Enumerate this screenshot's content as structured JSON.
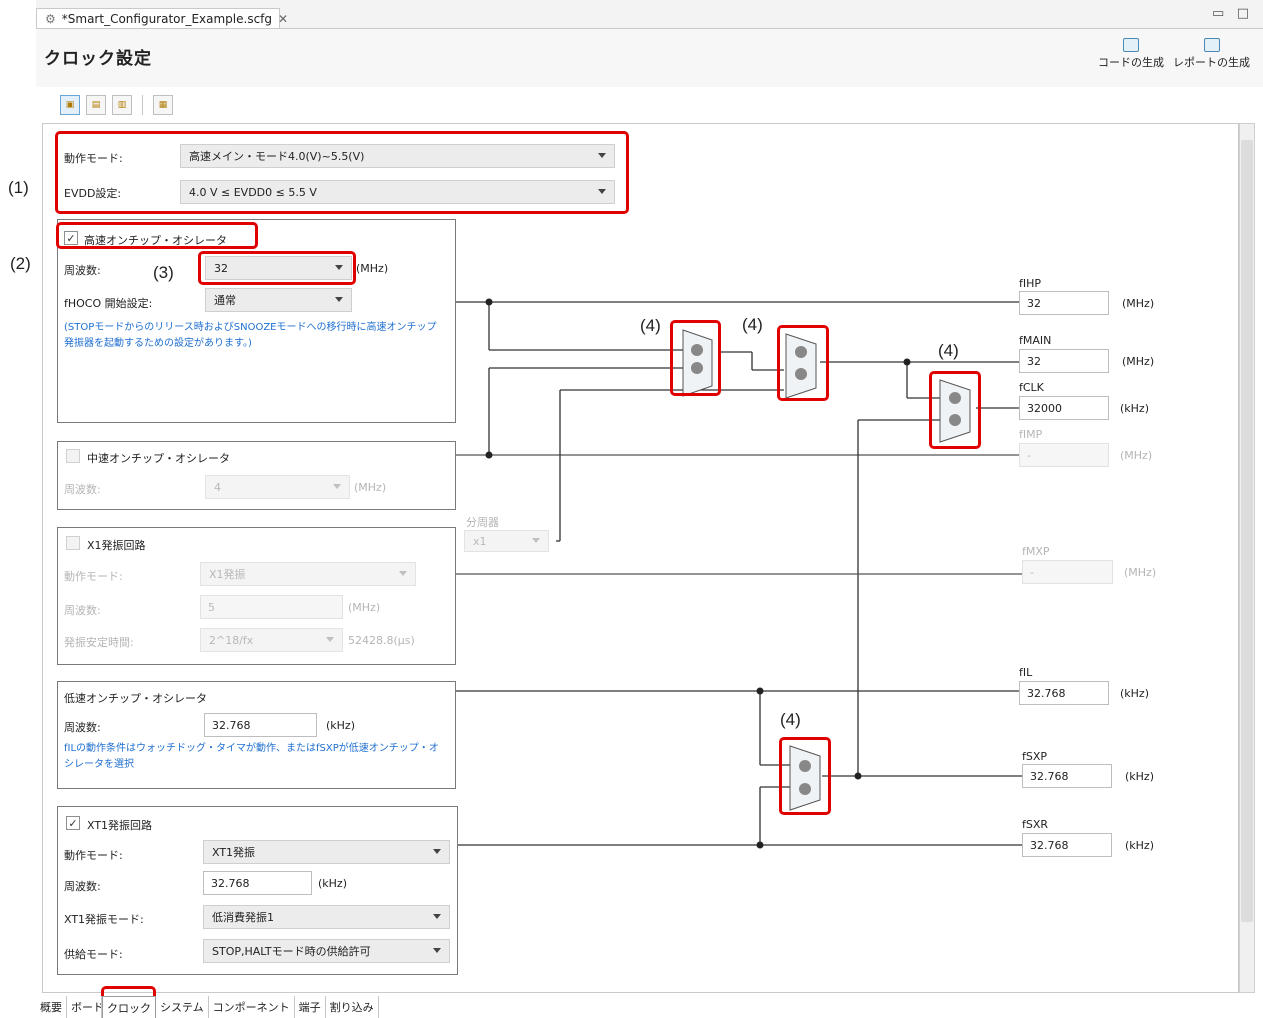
{
  "file_tab": {
    "label": "*Smart_Configurator_Example.scfg",
    "close": "✕"
  },
  "window_controls": [
    "▭",
    "□"
  ],
  "page_title": "クロック設定",
  "header_buttons": {
    "generate_code": "コードの生成",
    "generate_report": "レポートの生成"
  },
  "operation": {
    "mode_label": "動作モード:",
    "mode_value": "高速メイン・モード4.0(V)~5.5(V)",
    "evdd_label": "EVDD設定:",
    "evdd_value": "4.0 V ≤ EVDD0 ≤ 5.5 V"
  },
  "hoco": {
    "title": "高速オンチップ・オシレータ",
    "checked": "✓",
    "freq_label": "周波数:",
    "freq_value": "32",
    "freq_unit": "(MHz)",
    "start_label": "fHOCO 開始設定:",
    "start_value": "通常",
    "note": "(STOPモードからのリリース時およびSNOOZEモードへの移行時に高速オンチップ発振器を起動するための設定があります。)"
  },
  "moco": {
    "title": "中速オンチップ・オシレータ",
    "freq_label": "周波数:",
    "freq_value": "4",
    "freq_unit": "(MHz)"
  },
  "divider": {
    "label": "分周器",
    "value": "x1"
  },
  "x1": {
    "title": "X1発振回路",
    "mode_label": "動作モード:",
    "mode_value": "X1発振",
    "freq_label": "周波数:",
    "freq_value": "5",
    "freq_unit": "(MHz)",
    "stab_label": "発振安定時間:",
    "stab_value": "2^18/fx",
    "stab_time": "52428.8(μs)"
  },
  "loco": {
    "title": "低速オンチップ・オシレータ",
    "freq_label": "周波数:",
    "freq_value": "32.768",
    "freq_unit": "(kHz)",
    "note": "fILの動作条件はウォッチドッグ・タイマが動作、またはfSXPが低速オンチップ・オシレータを選択"
  },
  "xt1": {
    "title": "XT1発振回路",
    "checked": "✓",
    "mode_label": "動作モード:",
    "mode_value": "XT1発振",
    "freq_label": "周波数:",
    "freq_value": "32.768",
    "freq_unit": "(kHz)",
    "osc_mode_label": "XT1発振モード:",
    "osc_mode_value": "低消費発振1",
    "supply_label": "供給モード:",
    "supply_value": "STOP,HALTモード時の供給許可"
  },
  "outputs": {
    "fihp": {
      "label": "fIHP",
      "value": "32",
      "unit": "(MHz)"
    },
    "fmain": {
      "label": "fMAIN",
      "value": "32",
      "unit": "(MHz)"
    },
    "fclk": {
      "label": "fCLK",
      "value": "32000",
      "unit": "(kHz)"
    },
    "fimp": {
      "label": "fIMP",
      "value": "-",
      "unit": "(MHz)"
    },
    "fmxp": {
      "label": "fMXP",
      "value": "-",
      "unit": "(MHz)"
    },
    "fil": {
      "label": "fIL",
      "value": "32.768",
      "unit": "(kHz)"
    },
    "fsxp": {
      "label": "fSXP",
      "value": "32.768",
      "unit": "(kHz)"
    },
    "fsxr": {
      "label": "fSXR",
      "value": "32.768",
      "unit": "(kHz)"
    }
  },
  "annotations": {
    "a1": "(1)",
    "a2": "(2)",
    "a3": "(3)",
    "a4": "(4)"
  },
  "bottom_tabs": [
    "概要",
    "ボード",
    "クロック",
    "システム",
    "コンポーネント",
    "端子",
    "割り込み"
  ],
  "colors": {
    "highlight": "#e00000",
    "note_text": "#1f6fd1"
  }
}
